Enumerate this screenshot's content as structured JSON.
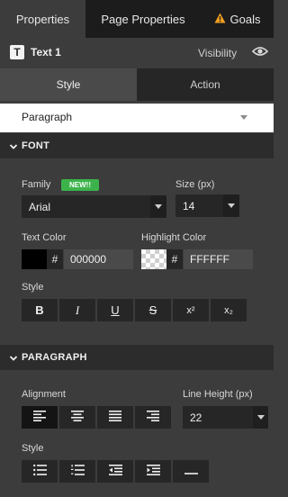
{
  "top_tabs": [
    {
      "label": "Properties",
      "active": true
    },
    {
      "label": "Page Properties",
      "active": false
    },
    {
      "label": "Goals",
      "active": false,
      "icon": "warning-icon",
      "icon_color": "#f0a020"
    }
  ],
  "element": {
    "badge": "T",
    "name": "Text 1",
    "visibility_label": "Visibility",
    "icon": "eye-icon"
  },
  "sub_tabs": [
    {
      "label": "Style",
      "active": true
    },
    {
      "label": "Action",
      "active": false
    }
  ],
  "paragraph_select": {
    "value": "Paragraph"
  },
  "font_section": {
    "title": "FONT",
    "family_label": "Family",
    "new_badge": "NEW!!",
    "badge_color": "#3cb34a",
    "family_value": "Arial",
    "size_label": "Size (px)",
    "size_value": "14",
    "text_color_label": "Text Color",
    "text_color_hash": "#",
    "text_color_value": "000000",
    "highlight_label": "Highlight Color",
    "highlight_hash": "#",
    "highlight_value": "FFFFFF",
    "style_label": "Style",
    "style_buttons": [
      "B",
      "I",
      "U",
      "S",
      "x²",
      "x₂"
    ]
  },
  "paragraph_section": {
    "title": "PARAGRAPH",
    "alignment_label": "Alignment",
    "line_height_label": "Line Height (px)",
    "line_height_value": "22",
    "alignment_buttons": [
      "align-left-icon",
      "align-center-icon",
      "align-justify-icon",
      "align-right-icon"
    ],
    "active_alignment": "align-left-icon",
    "style_label": "Style",
    "style_buttons": [
      "bulleted-list-icon",
      "numbered-list-icon",
      "outdent-icon",
      "indent-icon",
      "horizontal-rule-icon"
    ]
  }
}
